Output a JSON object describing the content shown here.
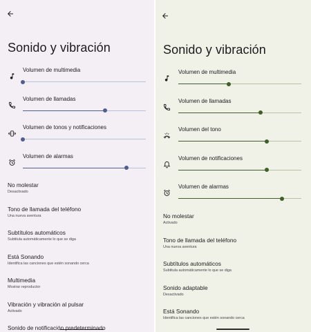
{
  "left": {
    "title": "Sonido y vibración",
    "accent": "#4d5e91",
    "track_color": "#b8c0de",
    "volumes": [
      {
        "icon": "music-note-icon",
        "label": "Volumen de multimedia",
        "level": 0.0
      },
      {
        "icon": "phone-icon",
        "label": "Volumen de llamadas",
        "level": 0.67
      },
      {
        "icon": "vibration-icon",
        "label": "Volumen de tonos y notificaciones",
        "level": 0.0
      },
      {
        "icon": "alarm-clock-icon",
        "label": "Volumen de alarmas",
        "level": 0.84
      }
    ],
    "settings": [
      {
        "title": "No molestar",
        "subtitle": "Desactivado"
      },
      {
        "title": "Tono de llamada del teléfono",
        "subtitle": "Una nueva aventura"
      },
      {
        "title": "Subtítulos automáticos",
        "subtitle": "Subtitula automáticamente lo que se diga"
      },
      {
        "title": "Está Sonando",
        "subtitle": "Identifica las canciones que estén sonando cerca"
      },
      {
        "title": "Multimedia",
        "subtitle": "Mostrar reproductor"
      },
      {
        "title": "Vibración y vibración al pulsar",
        "subtitle": "Activado"
      },
      {
        "title": "Sonido de notificación predeterminado",
        "subtitle": ""
      }
    ]
  },
  "right": {
    "title": "Sonido y vibración",
    "accent": "#3e5f26",
    "track_color": "#b5c3a3",
    "volumes": [
      {
        "icon": "music-note-icon",
        "label": "Volumen de multimedia",
        "level": 0.41
      },
      {
        "icon": "phone-icon",
        "label": "Volumen de llamadas",
        "level": 0.67
      },
      {
        "icon": "ringtone-icon",
        "label": "Volumen del tono",
        "level": 0.72
      },
      {
        "icon": "bell-icon",
        "label": "Volumen de notificaciones",
        "level": 0.72
      },
      {
        "icon": "alarm-clock-icon",
        "label": "Volumen de alarmas",
        "level": 0.84
      }
    ],
    "settings": [
      {
        "title": "No molestar",
        "subtitle": "Activado"
      },
      {
        "title": "Tono de llamada del teléfono",
        "subtitle": "Una nueva aventura"
      },
      {
        "title": "Subtítulos automáticos",
        "subtitle": "Subtitula automáticamente lo que se diga"
      },
      {
        "title": "Sonido adaptable",
        "subtitle": "Desactivado"
      },
      {
        "title": "Está Sonando",
        "subtitle": "Identifica las canciones que estén sonando cerca"
      }
    ]
  }
}
